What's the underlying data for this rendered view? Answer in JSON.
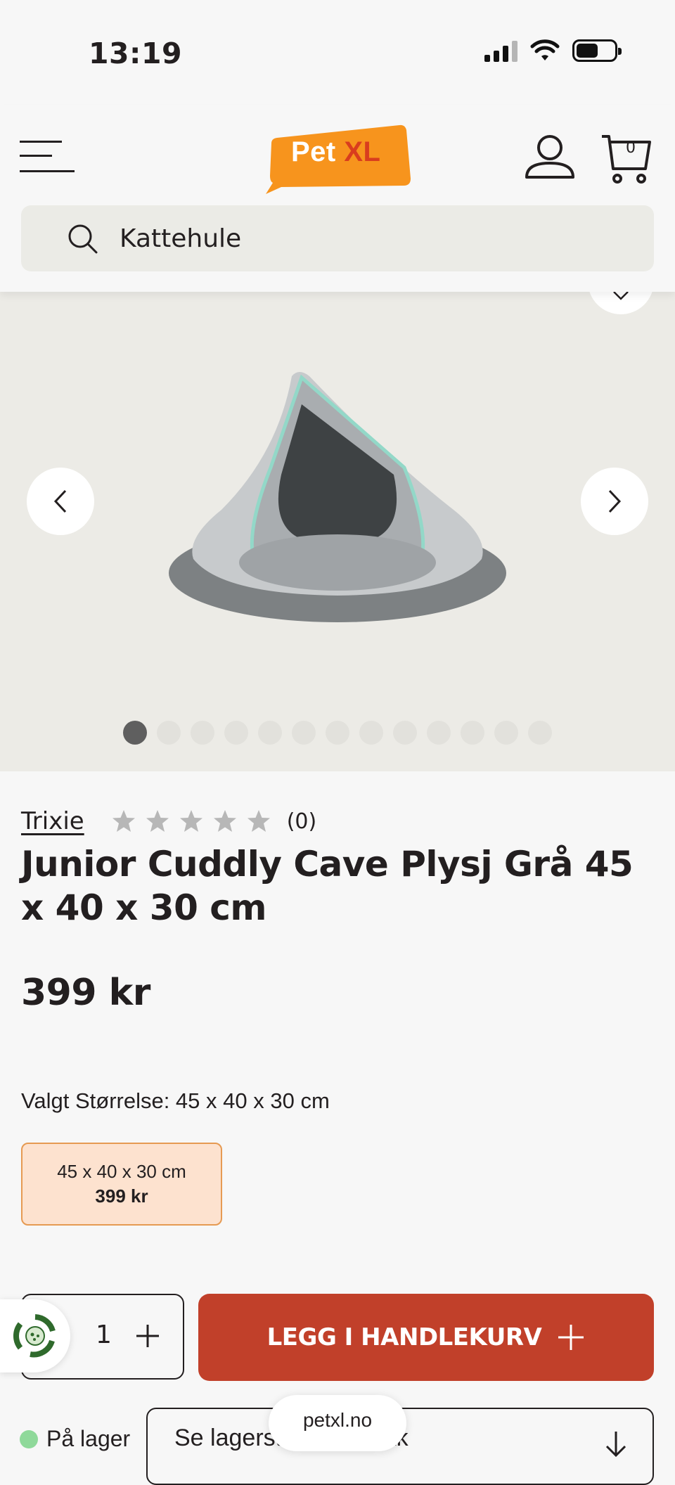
{
  "status_bar": {
    "time": "13:19"
  },
  "header": {
    "logo_pet": "Pet",
    "logo_xl": "XL",
    "cart_count": "0",
    "search_value": "Kattehule"
  },
  "gallery": {
    "image_count": 13,
    "active_index": 0,
    "prev_label": "<",
    "next_label": ">"
  },
  "product": {
    "brand": "Trixie",
    "rating_count": "(0)",
    "rating_stars": 0,
    "title": "Junior Cuddly Cave Plysj Grå 45 x 40 x 30 cm",
    "price": "399 kr",
    "size_label": "Valgt Størrelse: 45 x 40 x 30 cm",
    "size_option": {
      "size": "45 x 40 x 30 cm",
      "price": "399 kr"
    }
  },
  "purchase": {
    "quantity": "1",
    "add_to_cart_label": "LEGG I HANDLEKURV"
  },
  "stock": {
    "status": "På lager",
    "store_button_label": "Se lagerstatus i butikk"
  },
  "browser": {
    "url": "petxl.no"
  },
  "colors": {
    "brand_orange": "#f7941d",
    "accent_red": "#c1402a",
    "in_stock_green": "#8fd99a",
    "selected_size_bg": "#fde2cf"
  }
}
